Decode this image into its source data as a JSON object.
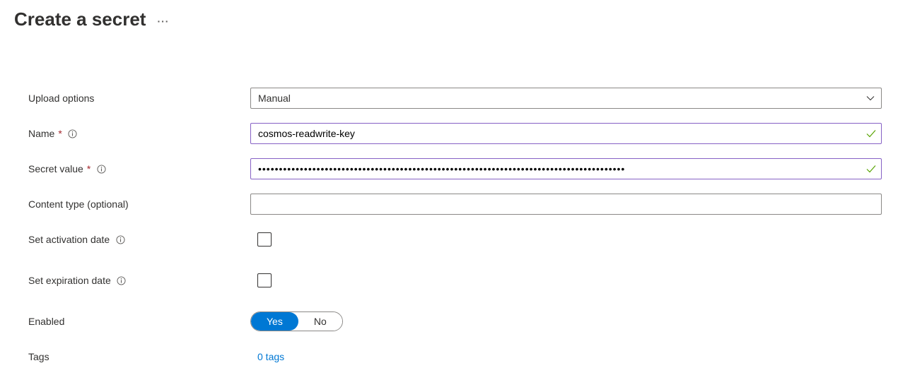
{
  "header": {
    "title": "Create a secret",
    "more": "···"
  },
  "form": {
    "uploadOptions": {
      "label": "Upload options",
      "value": "Manual"
    },
    "name": {
      "label": "Name",
      "value": "cosmos-readwrite-key"
    },
    "secretValue": {
      "label": "Secret value",
      "masked": "••••••••••••••••••••••••••••••••••••••••••••••••••••••••••••••••••••••••••••••••••••••••"
    },
    "contentType": {
      "label": "Content type (optional)",
      "value": ""
    },
    "activationDate": {
      "label": "Set activation date"
    },
    "expirationDate": {
      "label": "Set expiration date"
    },
    "enabled": {
      "label": "Enabled",
      "yes": "Yes",
      "no": "No"
    },
    "tags": {
      "label": "Tags",
      "value": "0 tags"
    }
  }
}
